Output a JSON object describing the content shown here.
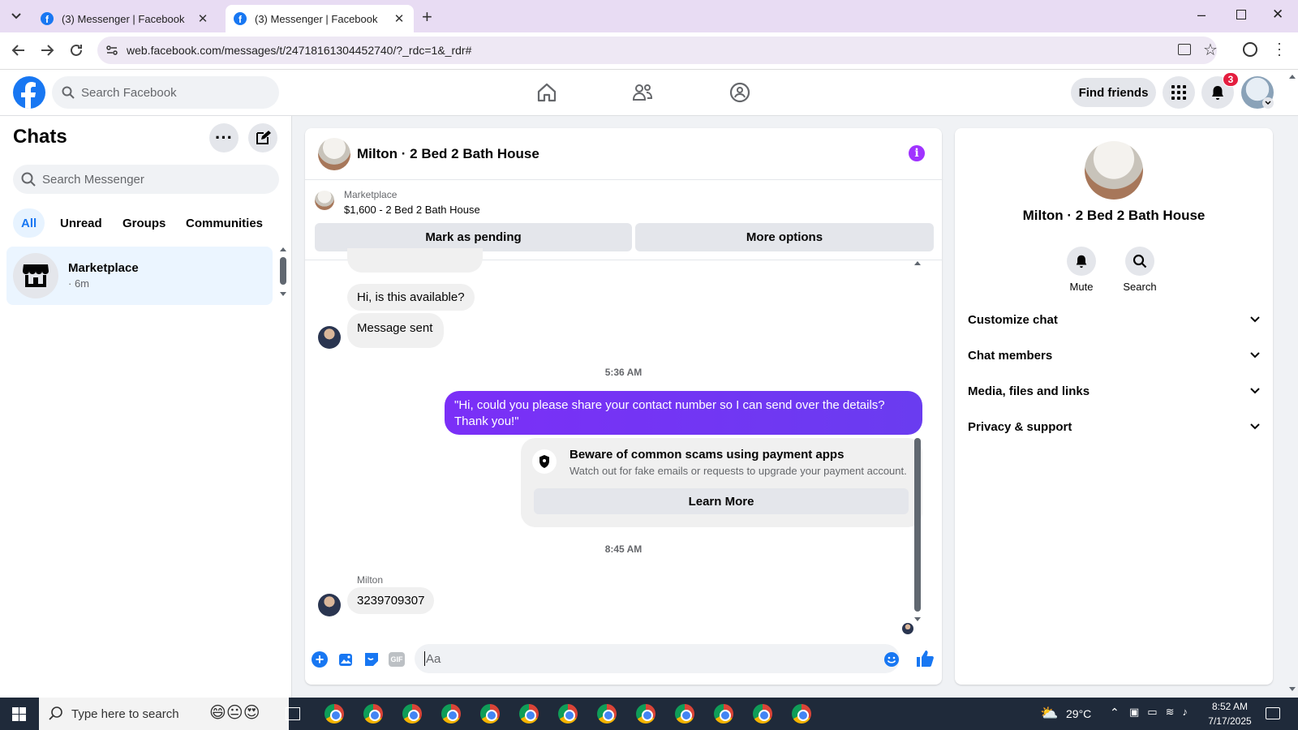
{
  "browser": {
    "tabs": [
      {
        "title": "(3) Messenger | Facebook",
        "active": false
      },
      {
        "title": "(3) Messenger | Facebook",
        "active": true
      }
    ],
    "url": "web.facebook.com/messages/t/24718161304452740/?_rdc=1&_rdr#"
  },
  "fb_header": {
    "search_placeholder": "Search Facebook",
    "find_friends": "Find friends",
    "notification_count": "3"
  },
  "sidebar": {
    "title": "Chats",
    "search_placeholder": "Search Messenger",
    "filters": [
      "All",
      "Unread",
      "Groups",
      "Communities"
    ],
    "active_filter": "All",
    "chats": [
      {
        "name": "Marketplace",
        "time": "· 6m"
      }
    ]
  },
  "chat": {
    "title": "Milton · 2 Bed 2 Bath House",
    "listing": {
      "source": "Marketplace",
      "summary": "$1,600 - 2 Bed 2 Bath House",
      "mark_pending": "Mark as pending",
      "more_options": "More options"
    },
    "messages": {
      "m1": "Hi, is this available?",
      "m2": "Message sent",
      "ts1": "5:36 AM",
      "m3_line1": "\"Hi, could you please share your contact number so I can send over the details?",
      "m3_line2": "Thank you!\"",
      "scam_title": "Beware of common scams using payment apps",
      "scam_body": "Watch out for fake emails or requests to upgrade your payment account.",
      "learn_more": "Learn More",
      "ts2": "8:45 AM",
      "sender": "Milton",
      "m4": "3239709307"
    },
    "composer_placeholder": "Aa"
  },
  "info_panel": {
    "title": "Milton · 2 Bed 2 Bath House",
    "mute": "Mute",
    "search": "Search",
    "sections": [
      "Customize chat",
      "Chat members",
      "Media, files and links",
      "Privacy & support"
    ]
  },
  "taskbar": {
    "search_placeholder": "Type here to search",
    "temperature": "29°C",
    "time": "8:52 AM",
    "date": "7/17/2025"
  },
  "colors": {
    "fb_blue": "#1877f2",
    "outgoing_bubble": "#7b2ff7",
    "messenger_purple": "#a033ff"
  }
}
